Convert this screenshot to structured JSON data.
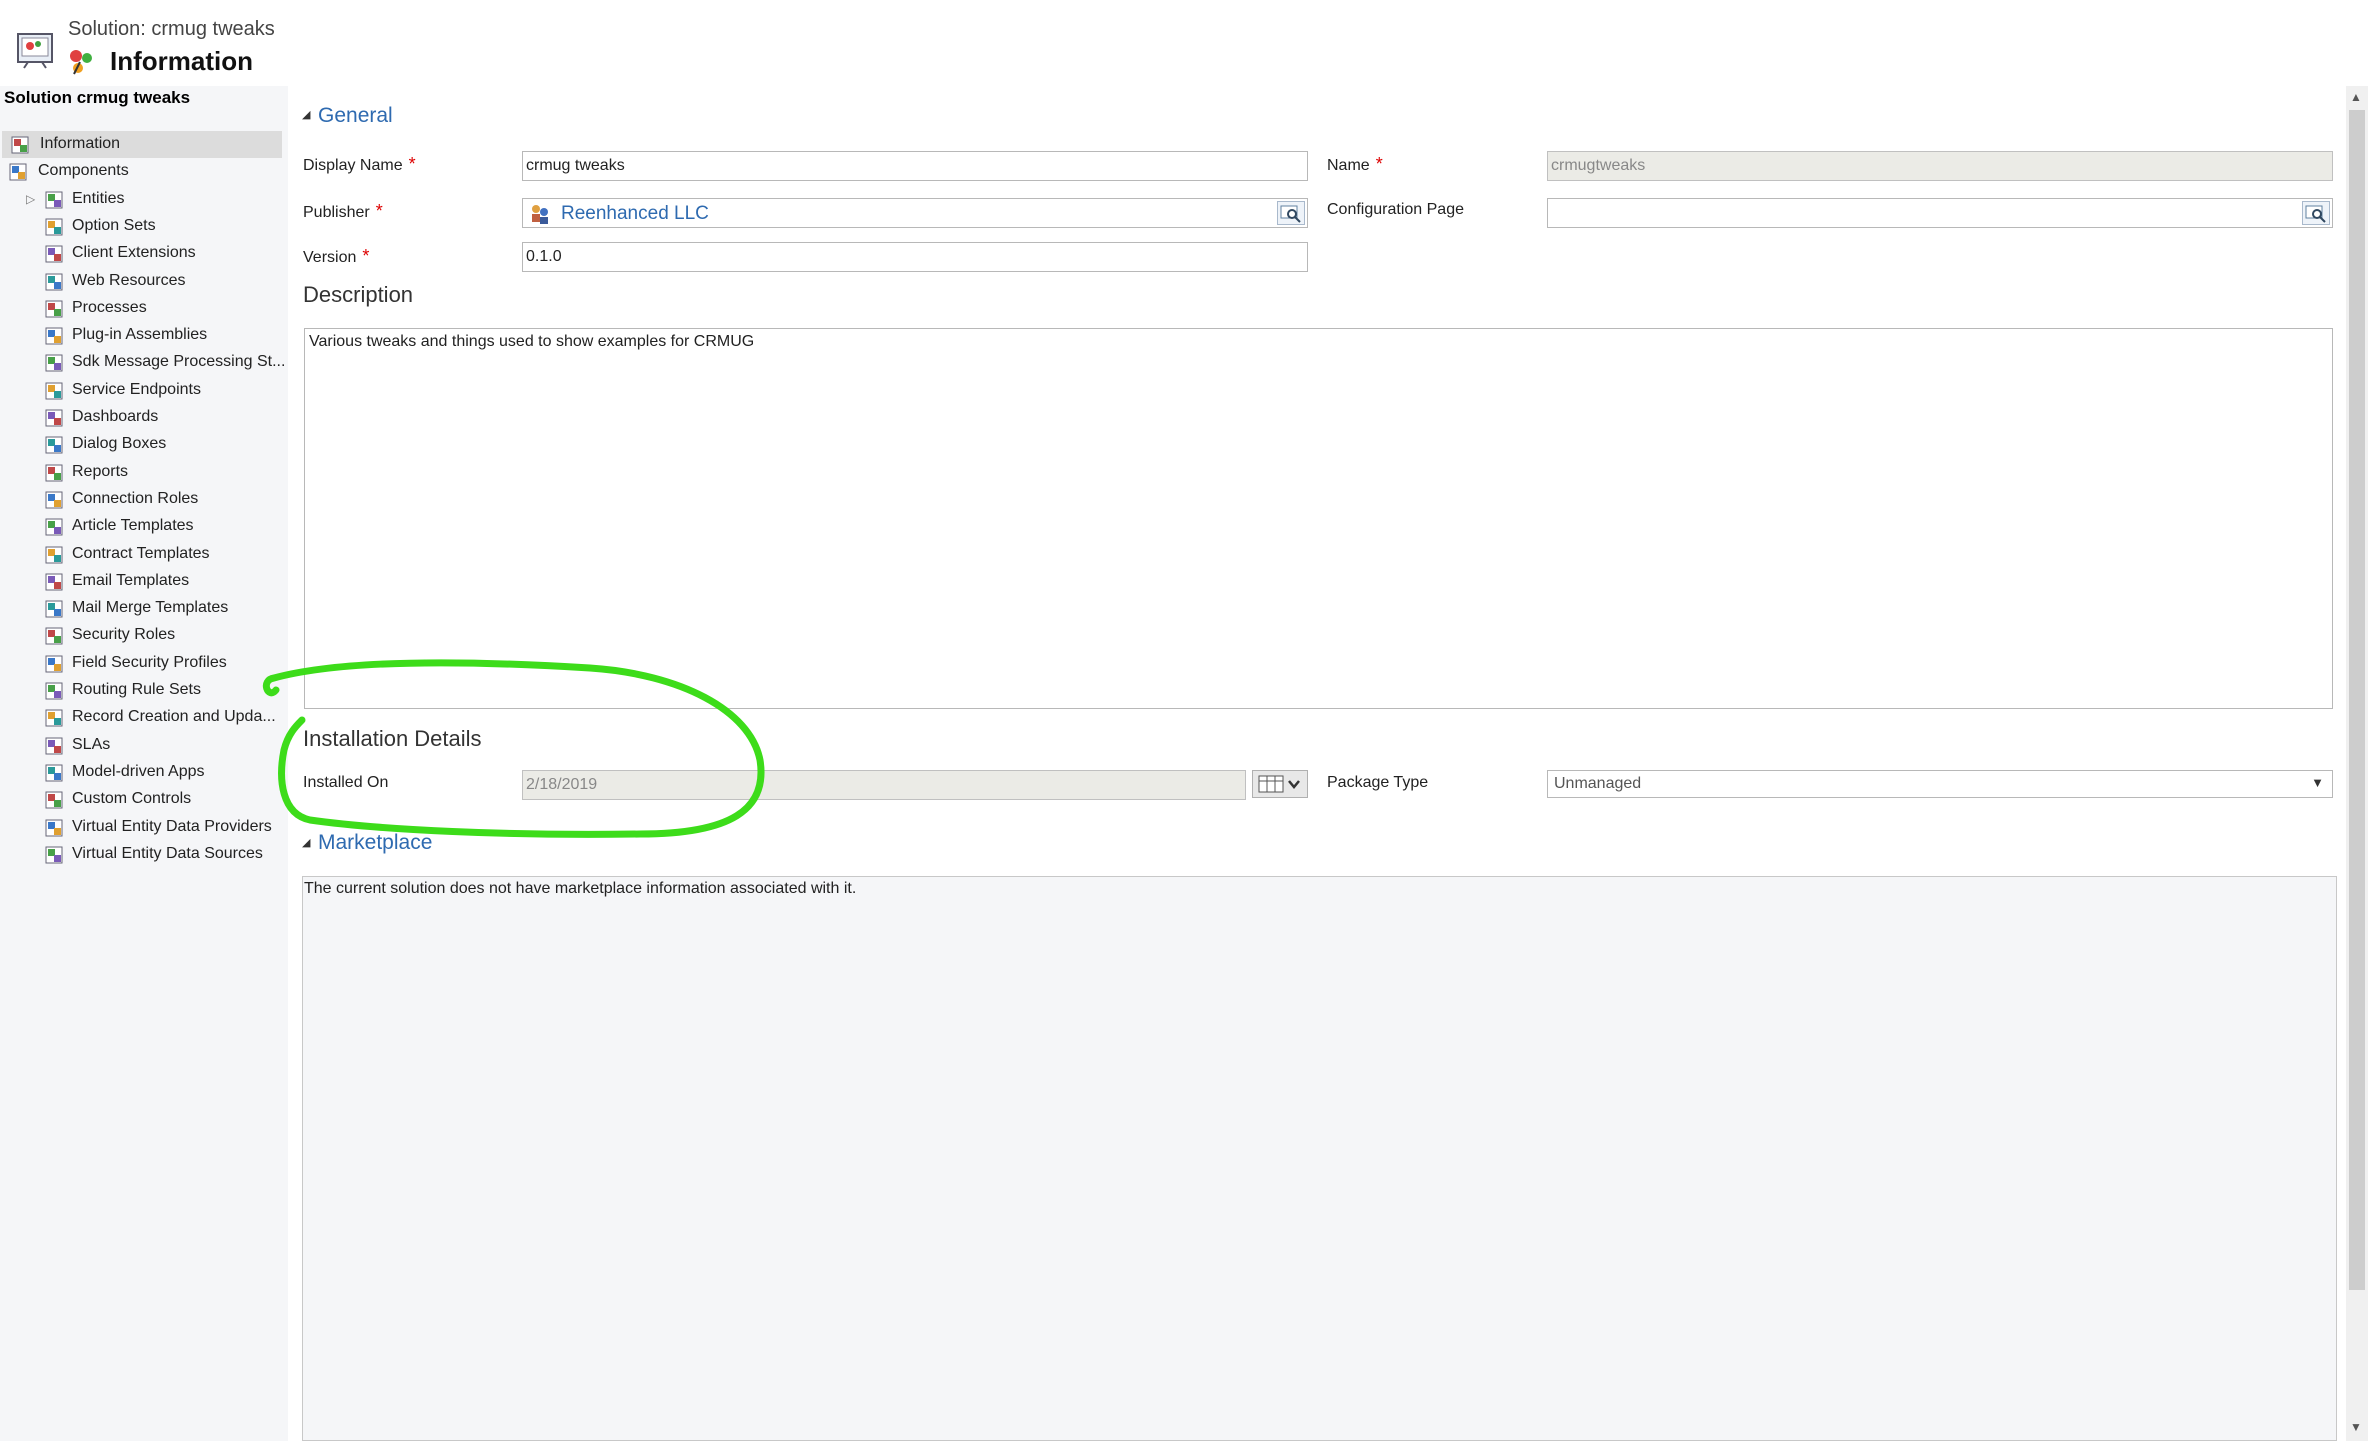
{
  "header": {
    "subtitle": "Solution: crmug tweaks",
    "title": "Information"
  },
  "sidebar": {
    "heading": "Solution crmug tweaks",
    "items": [
      {
        "label": "Information",
        "icon": "information-icon",
        "selected": true
      },
      {
        "label": "Components",
        "icon": "components-icon"
      },
      {
        "label": "Entities",
        "icon": "entities-icon",
        "expandable": true
      },
      {
        "label": "Option Sets",
        "icon": "option-sets-icon"
      },
      {
        "label": "Client Extensions",
        "icon": "client-extensions-icon"
      },
      {
        "label": "Web Resources",
        "icon": "web-resources-icon"
      },
      {
        "label": "Processes",
        "icon": "processes-icon"
      },
      {
        "label": "Plug-in Assemblies",
        "icon": "plugin-assemblies-icon"
      },
      {
        "label": "Sdk Message Processing St...",
        "icon": "sdk-message-icon"
      },
      {
        "label": "Service Endpoints",
        "icon": "service-endpoints-icon"
      },
      {
        "label": "Dashboards",
        "icon": "dashboards-icon"
      },
      {
        "label": "Dialog Boxes",
        "icon": "dialog-boxes-icon"
      },
      {
        "label": "Reports",
        "icon": "reports-icon"
      },
      {
        "label": "Connection Roles",
        "icon": "connection-roles-icon"
      },
      {
        "label": "Article Templates",
        "icon": "article-templates-icon"
      },
      {
        "label": "Contract Templates",
        "icon": "contract-templates-icon"
      },
      {
        "label": "Email Templates",
        "icon": "email-templates-icon"
      },
      {
        "label": "Mail Merge Templates",
        "icon": "mail-merge-templates-icon"
      },
      {
        "label": "Security Roles",
        "icon": "security-roles-icon"
      },
      {
        "label": "Field Security Profiles",
        "icon": "field-security-profiles-icon"
      },
      {
        "label": "Routing Rule Sets",
        "icon": "routing-rule-sets-icon"
      },
      {
        "label": "Record Creation and Upda...",
        "icon": "record-creation-icon"
      },
      {
        "label": "SLAs",
        "icon": "slas-icon"
      },
      {
        "label": "Model-driven Apps",
        "icon": "model-driven-apps-icon"
      },
      {
        "label": "Custom Controls",
        "icon": "custom-controls-icon"
      },
      {
        "label": "Virtual Entity Data Providers",
        "icon": "virtual-entity-providers-icon"
      },
      {
        "label": "Virtual Entity Data Sources",
        "icon": "virtual-entity-sources-icon"
      }
    ]
  },
  "general": {
    "section_title": "General",
    "display_name_label": "Display Name",
    "display_name_value": "crmug tweaks",
    "name_label": "Name",
    "name_value": "crmugtweaks",
    "publisher_label": "Publisher",
    "publisher_value": "Reenhanced LLC",
    "config_page_label": "Configuration Page",
    "config_page_value": "",
    "version_label": "Version",
    "version_value": "0.1.0",
    "required_mark": "*"
  },
  "description": {
    "title": "Description",
    "value": "Various tweaks and things used to show examples for CRMUG"
  },
  "installation": {
    "title": "Installation Details",
    "installed_on_label": "Installed On",
    "installed_on_value": "2/18/2019",
    "package_type_label": "Package Type",
    "package_type_value": "Unmanaged"
  },
  "marketplace": {
    "section_title": "Marketplace",
    "message": "The current solution does not have marketplace information associated with it."
  },
  "colors": {
    "link_blue": "#2e6ab0",
    "required_red": "#dd0000",
    "annotation_green": "#3ddc1a",
    "sidebar_bg": "#f5f6f8",
    "selected_bg": "#dcdcdc"
  }
}
